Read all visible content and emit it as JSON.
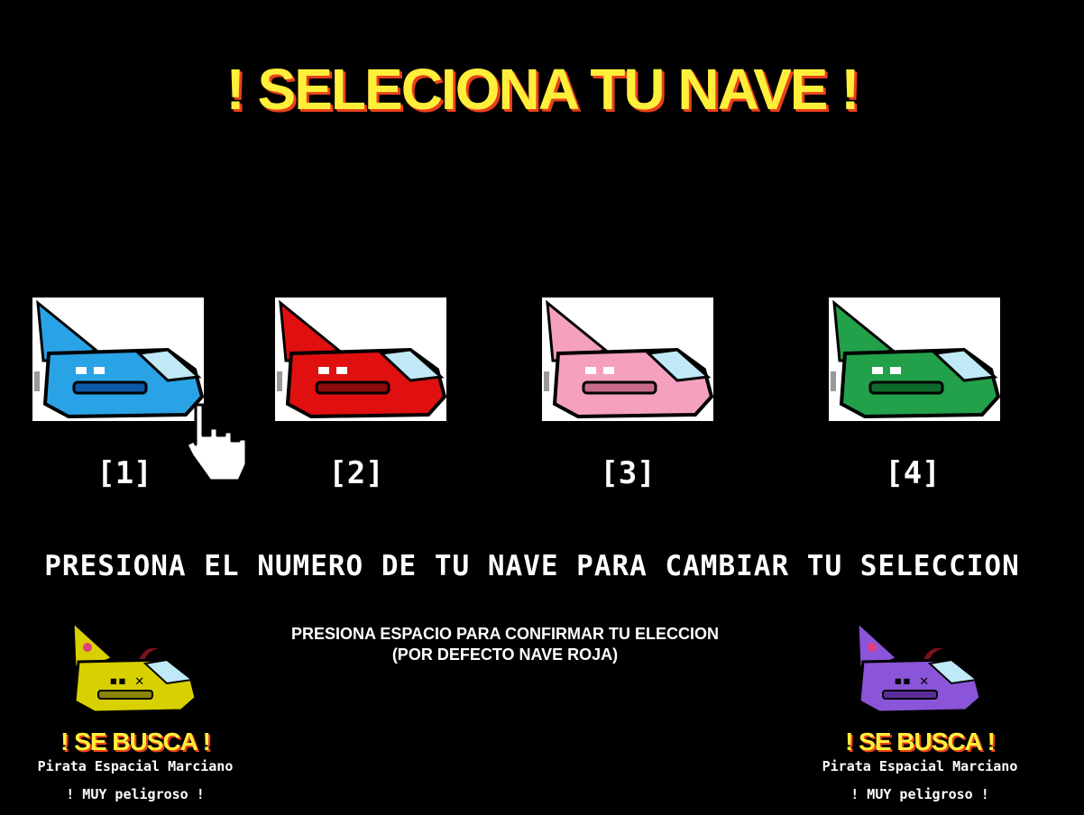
{
  "title": "! SELECIONA TU NAVE !",
  "ships": [
    {
      "number": "[1]",
      "color": "#2aa3e6",
      "dark": "#0b58a8",
      "cone": "#2aa3e6"
    },
    {
      "number": "[2]",
      "color": "#e01010",
      "dark": "#8c0a0a",
      "cone": "#e01010"
    },
    {
      "number": "[3]",
      "color": "#f5a0bf",
      "dark": "#c96a8c",
      "cone": "#f5a0bf"
    },
    {
      "number": "[4]",
      "color": "#22a04a",
      "dark": "#0e6a2a",
      "cone": "#22a04a"
    }
  ],
  "instructions": {
    "change": "PRESIONA EL NUMERO DE TU NAVE PARA CAMBIAR TU SELECCION",
    "confirm_line1": "PRESIONA ESPACIO PARA CONFIRMAR TU ELECCION",
    "confirm_line2": "(POR DEFECTO NAVE ROJA)"
  },
  "wanted": [
    {
      "title": "! SE BUSCA !",
      "subtitle": "Pirata Espacial Marciano",
      "warning": "! MUY peligroso !",
      "color": "#d8d000"
    },
    {
      "title": "! SE BUSCA !",
      "subtitle": "Pirata Espacial Marciano",
      "warning": "! MUY peligroso !",
      "color": "#8a55d8"
    }
  ]
}
